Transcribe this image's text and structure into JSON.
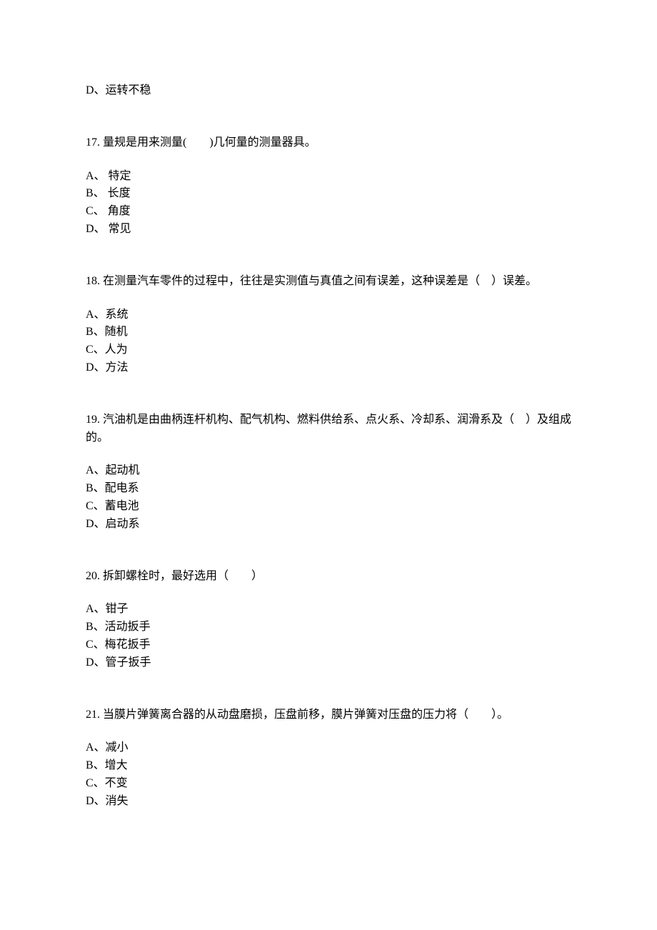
{
  "orphan_choice": "D、运转不稳",
  "questions": [
    {
      "number": "17.",
      "text": "量规是用来测量(　　)几何量的测量器具。",
      "choices": [
        "A、  特定",
        "B、  长度",
        "C、  角度",
        "D、  常见"
      ]
    },
    {
      "number": "18.",
      "text": "在测量汽车零件的过程中，往往是实测值与真值之间有误差，这种误差是（　）误差。",
      "choices": [
        "A、系统",
        "B、随机",
        "C、人为",
        "D、方法"
      ]
    },
    {
      "number": "19.",
      "text": "汽油机是由曲柄连杆机构、配气机构、燃料供给系、点火系、冷却系、润滑系及（　）及组成的。",
      "choices": [
        "A、起动机",
        "B、配电系",
        "C、蓄电池",
        "D、启动系"
      ]
    },
    {
      "number": "20.",
      "text": "拆卸螺栓时，最好选用（　　）",
      "choices": [
        "A、钳子",
        "B、活动扳手",
        "C、梅花扳手",
        "D、管子扳手"
      ]
    },
    {
      "number": "21.",
      "text": "当膜片弹簧离合器的从动盘磨损，压盘前移，膜片弹簧对压盘的压力将（　　）。",
      "choices": [
        "A、减小",
        "B、增大",
        "C、不变",
        "D、消失"
      ]
    }
  ]
}
